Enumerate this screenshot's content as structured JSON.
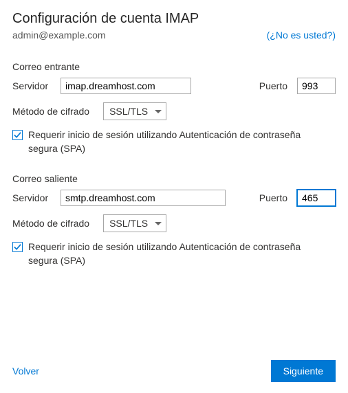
{
  "title": "Configuración de cuenta IMAP",
  "email": "admin@example.com",
  "not_you": "(¿No es usted?)",
  "incoming": {
    "heading": "Correo entrante",
    "server_label": "Servidor",
    "server_value": "imap.dreamhost.com",
    "port_label": "Puerto",
    "port_value": "993",
    "encryption_label": "Método de cifrado",
    "encryption_value": "SSL/TLS",
    "spa_checked": true,
    "spa_label": "Requerir inicio de sesión utilizando Autenticación de contraseña segura (SPA)"
  },
  "outgoing": {
    "heading": "Correo saliente",
    "server_label": "Servidor",
    "server_value": "smtp.dreamhost.com",
    "port_label": "Puerto",
    "port_value": "465",
    "encryption_label": "Método de cifrado",
    "encryption_value": "SSL/TLS",
    "spa_checked": true,
    "spa_label": "Requerir inicio de sesión utilizando Autenticación de contraseña segura (SPA)"
  },
  "footer": {
    "back": "Volver",
    "next": "Siguiente"
  }
}
